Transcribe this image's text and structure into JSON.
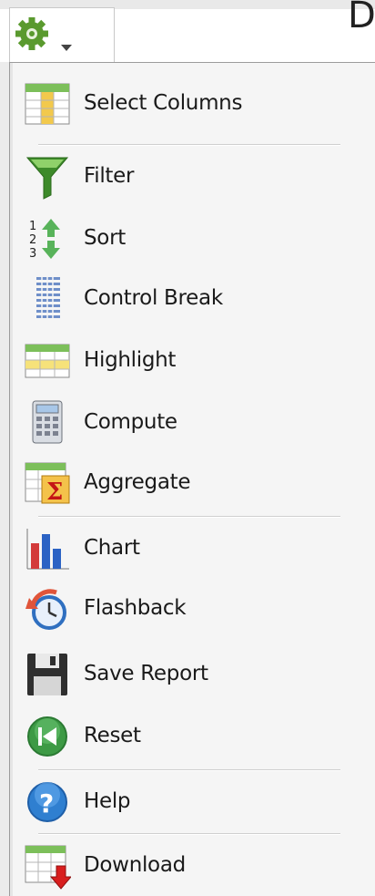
{
  "header": {
    "letter": "D",
    "gear_button_icon": "gear-with-dropdown-icon"
  },
  "menu": {
    "items": [
      {
        "label": "Select Columns",
        "icon": "select-columns-icon"
      },
      {
        "label": "Filter",
        "icon": "filter-funnel-icon"
      },
      {
        "label": "Sort",
        "icon": "sort-icon"
      },
      {
        "label": "Control Break",
        "icon": "control-break-icon"
      },
      {
        "label": "Highlight",
        "icon": "highlight-icon"
      },
      {
        "label": "Compute",
        "icon": "calculator-icon"
      },
      {
        "label": "Aggregate",
        "icon": "sigma-icon"
      },
      {
        "label": "Chart",
        "icon": "bar-chart-icon"
      },
      {
        "label": "Flashback",
        "icon": "clock-undo-icon"
      },
      {
        "label": "Save Report",
        "icon": "floppy-disk-icon"
      },
      {
        "label": "Reset",
        "icon": "reset-icon"
      },
      {
        "label": "Help",
        "icon": "help-icon"
      },
      {
        "label": "Download",
        "icon": "download-icon"
      }
    ]
  },
  "colors": {
    "menu_background": "#f5f5f5",
    "gear_green": "#5a9a2e",
    "filter_green": "#3d8a2a",
    "help_blue": "#2f7fd0",
    "download_red": "#d81e1e"
  }
}
